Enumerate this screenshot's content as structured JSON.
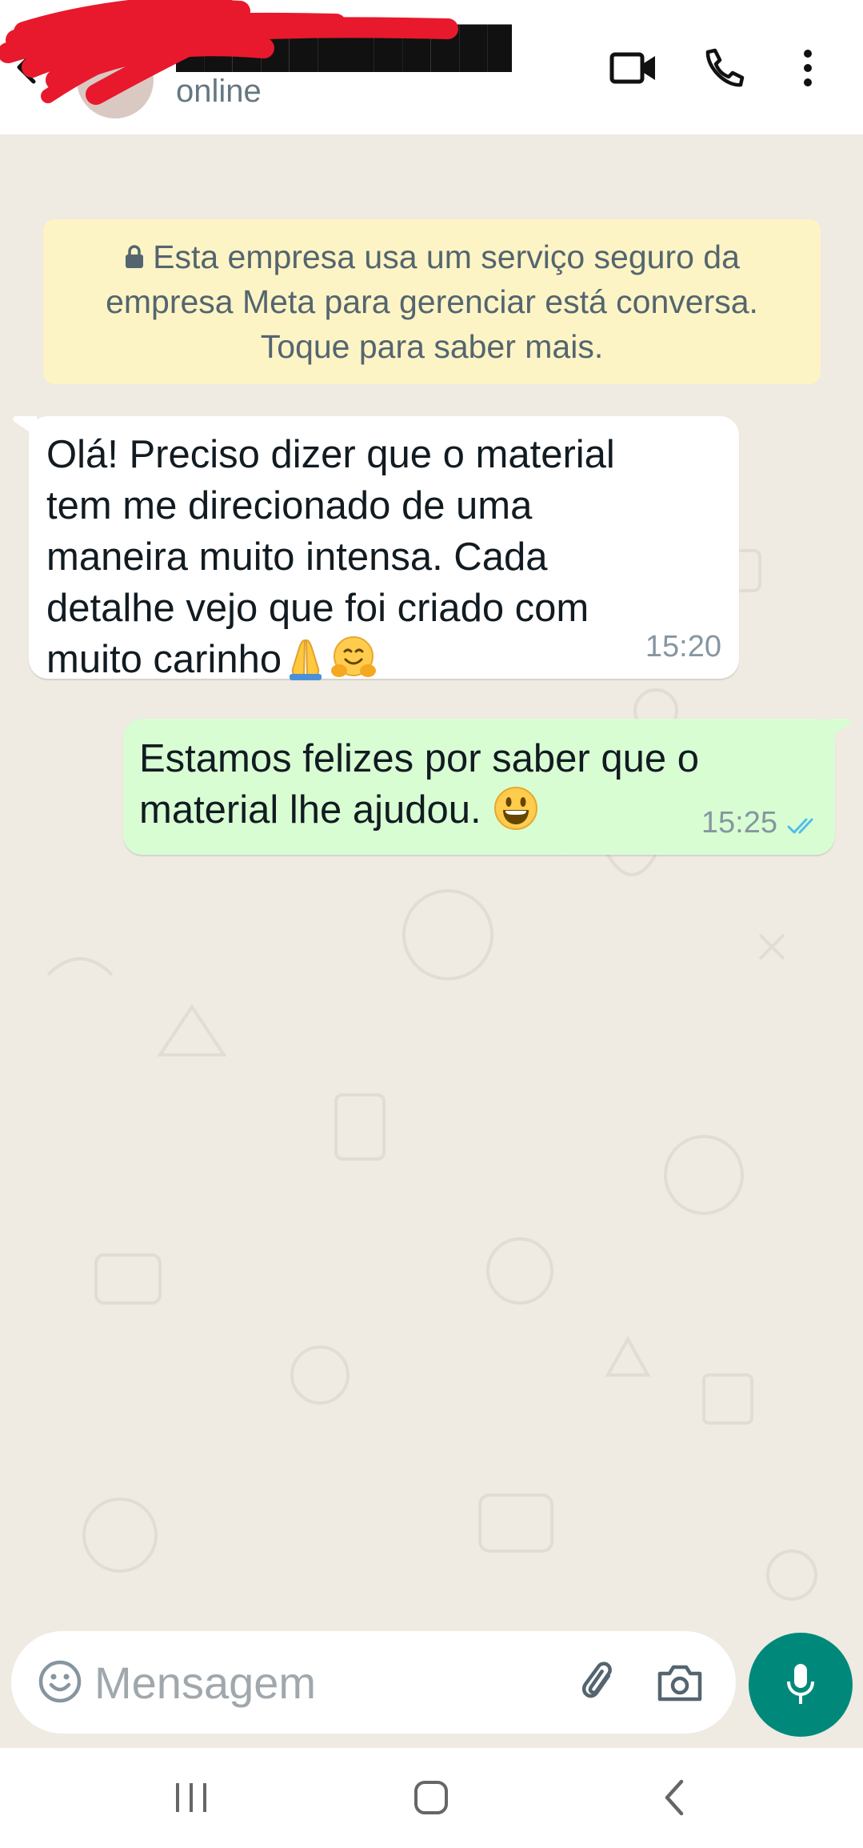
{
  "header": {
    "contact_name": "████████████",
    "status": "online",
    "icons": [
      "back-arrow-icon",
      "video-call-icon",
      "voice-call-icon",
      "more-options-icon"
    ]
  },
  "chat": {
    "encryption_notice": {
      "lines": [
        "Esta empresa usa um serviço seguro da",
        "empresa Meta para gerenciar está conversa.",
        "Toque para saber mais."
      ],
      "icon": "lock-icon"
    },
    "messages": [
      {
        "direction": "incoming",
        "lines": [
          "Olá! Preciso dizer que o material",
          "tem me direcionado de uma",
          "maneira muito intensa. Cada",
          "detalhe vejo que foi criado com",
          "muito carinho"
        ],
        "emojis": [
          "folded-hands-emoji",
          "hugging-face-emoji"
        ],
        "time": "15:20"
      },
      {
        "direction": "outgoing",
        "lines": [
          "Estamos felizes por saber que o",
          "material lhe ajudou."
        ],
        "emojis": [
          "grinning-face-emoji"
        ],
        "time": "15:25",
        "status": "read",
        "tick_color": "#53bdeb"
      }
    ]
  },
  "composer": {
    "placeholder": "Mensagem",
    "icons": [
      "emoji-icon",
      "attach-icon",
      "camera-icon",
      "mic-icon"
    ]
  },
  "navbar": {
    "icons": [
      "recent-apps-icon",
      "home-icon",
      "back-icon"
    ]
  },
  "colors": {
    "chat_background": "#efeae2",
    "incoming_bubble": "#ffffff",
    "outgoing_bubble": "#d9fdd3",
    "notice_background": "#fdf4c5",
    "accent": "#00897b",
    "redaction": "#e8192c"
  }
}
